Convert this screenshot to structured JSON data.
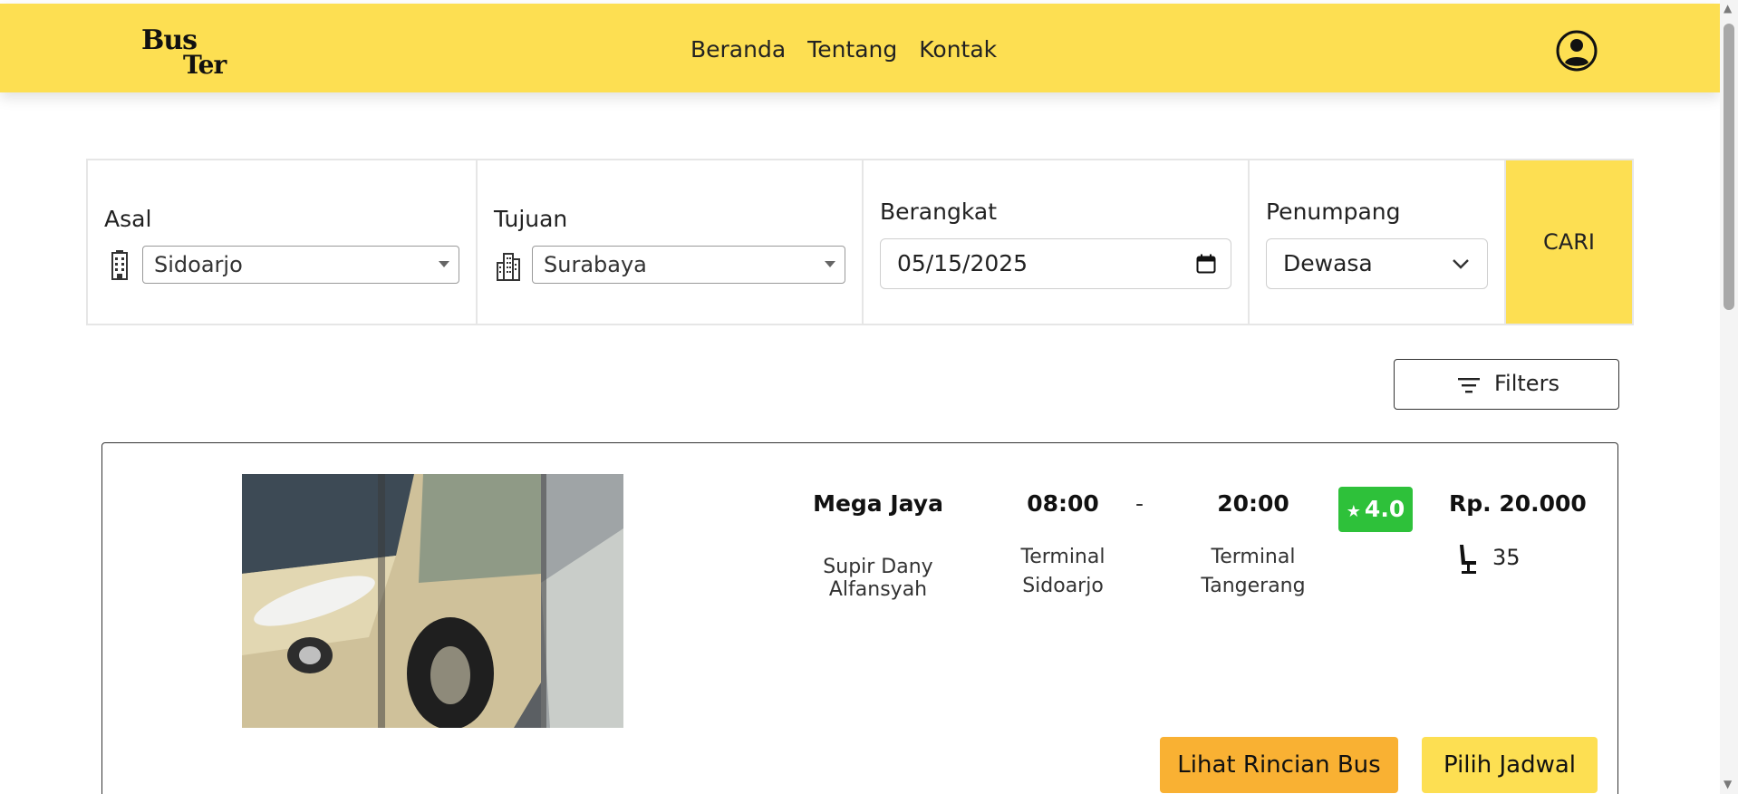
{
  "header": {
    "logo_line1": "Bus",
    "logo_line2": "Ter",
    "nav": [
      "Beranda",
      "Tentang",
      "Kontak"
    ],
    "profile_icon": "user-circle-icon"
  },
  "search": {
    "origin": {
      "label": "Asal",
      "value": "Sidoarjo",
      "icon": "building-icon"
    },
    "destination": {
      "label": "Tujuan",
      "value": "Surabaya",
      "icon": "city-icon"
    },
    "departure": {
      "label": "Berangkat",
      "value": "05/15/2025",
      "icon": "calendar-icon"
    },
    "passenger": {
      "label": "Penumpang",
      "value": "Dewasa",
      "icon": "chevron-down-icon"
    },
    "submit_label": "CARI"
  },
  "filters": {
    "label": "Filters",
    "icon": "filter-icon"
  },
  "results": [
    {
      "operator": "Mega Jaya",
      "driver": "Supir Dany Alfansyah",
      "departure_time": "08:00",
      "separator": "-",
      "arrival_time": "20:00",
      "departure_terminal_line1": "Terminal",
      "departure_terminal_line2": "Sidoarjo",
      "arrival_terminal_line1": "Terminal",
      "arrival_terminal_line2": "Tangerang",
      "rating": "4.0",
      "price": "Rp. 20.000",
      "seats": "35",
      "detail_button": "Lihat Rincian Bus",
      "schedule_button": "Pilih Jadwal"
    }
  ],
  "colors": {
    "brand_yellow": "#fddf52",
    "rating_green": "#2ec13a",
    "detail_orange": "#f9b133"
  }
}
